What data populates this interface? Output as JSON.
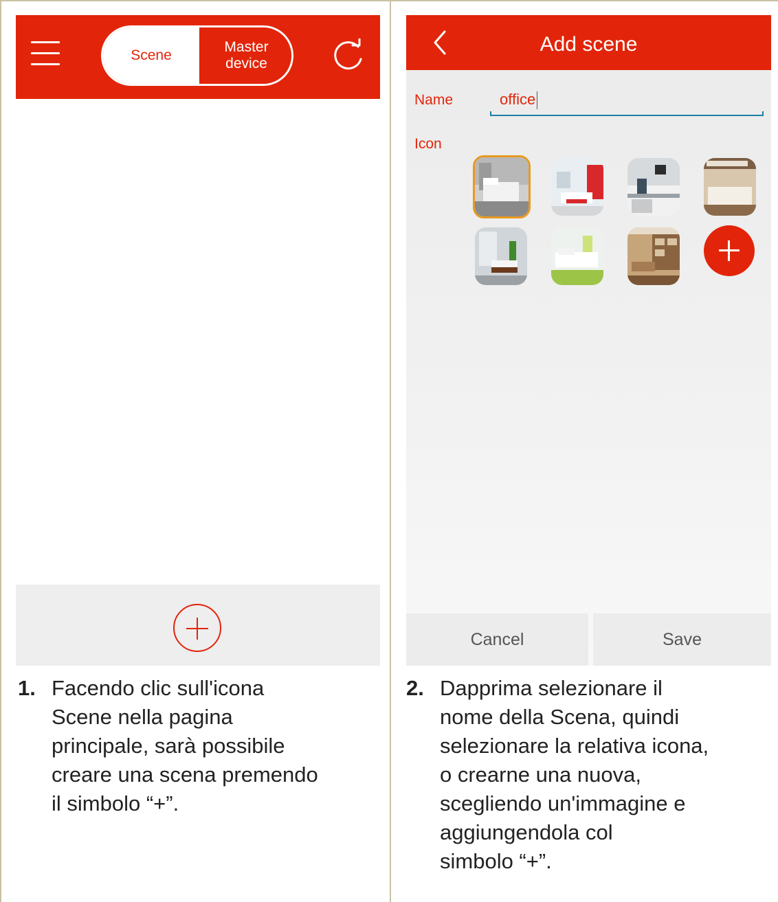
{
  "left_screen": {
    "tabs": {
      "scene": "Scene",
      "master_line1": "Master",
      "master_line2": "device"
    }
  },
  "right_screen": {
    "title": "Add scene",
    "name_label": "Name",
    "name_value": "office",
    "icon_label": "Icon",
    "icons": [
      "bedroom-icon",
      "living-room-icon",
      "kitchen-icon",
      "bedroom-2-icon",
      "bathroom-icon",
      "lounge-icon",
      "study-icon"
    ],
    "cancel_label": "Cancel",
    "save_label": "Save"
  },
  "captions": [
    {
      "number": "1.",
      "lines": [
        "Facendo clic sull'icona",
        "Scene nella pagina",
        "principale, sarà possibile",
        "creare una scena premendo",
        "il simbolo “+”."
      ]
    },
    {
      "number": "2.",
      "lines": [
        "Dapprima selezionare il",
        "nome della Scena, quindi",
        "selezionare la relativa icona,",
        "o crearne una nuova,",
        "scegliendo un'immagine e",
        "aggiungendola col",
        "simbolo “+”."
      ]
    }
  ],
  "colors": {
    "brand_red": "#e2250a",
    "selection": "#e89a1e",
    "underline": "#1c7fa6"
  }
}
